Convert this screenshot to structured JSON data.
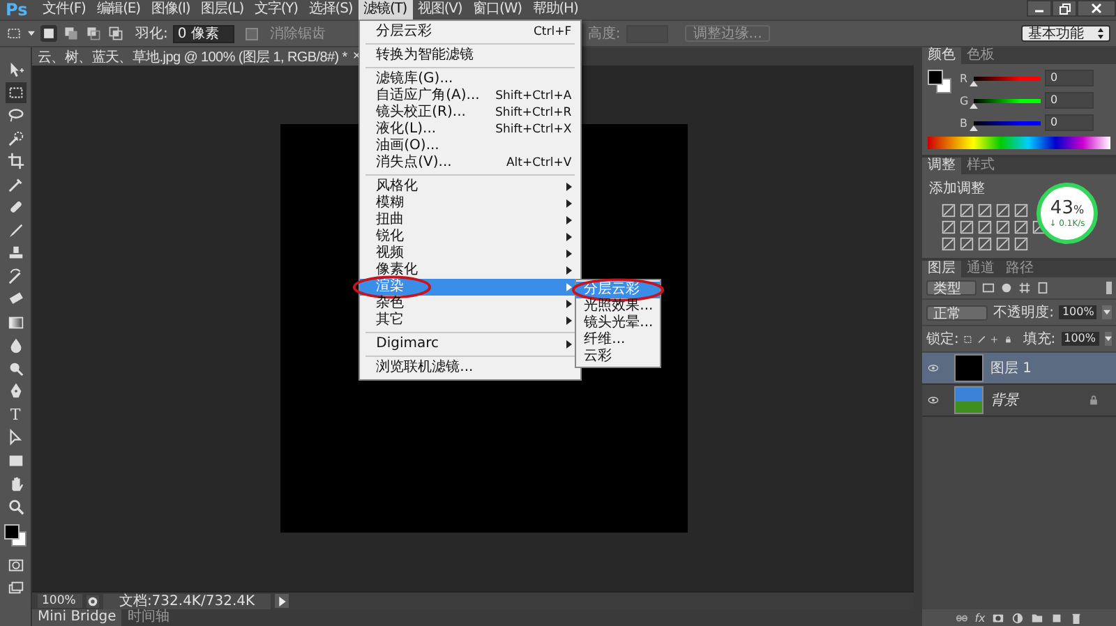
{
  "menu_bar": {
    "logo": "Ps",
    "items": [
      {
        "label": "文件(F)",
        "selected": false
      },
      {
        "label": "编辑(E)",
        "selected": false
      },
      {
        "label": "图像(I)",
        "selected": false
      },
      {
        "label": "图层(L)",
        "selected": false
      },
      {
        "label": "文字(Y)",
        "selected": false
      },
      {
        "label": "选择(S)",
        "selected": false
      },
      {
        "label": "滤镜(T)",
        "selected": true
      },
      {
        "label": "视图(V)",
        "selected": false
      },
      {
        "label": "窗口(W)",
        "selected": false
      },
      {
        "label": "帮助(H)",
        "selected": false
      }
    ]
  },
  "options_bar": {
    "feather_label": "羽化:",
    "feather_value": "0 像素",
    "anti_alias_label": "消除锯齿",
    "anti_alias_checked": false,
    "height_label": "高度:",
    "refine_button": "调整边缘...",
    "workspace": "基本功能"
  },
  "document_tab": {
    "title": "云、树、蓝天、草地.jpg @ 100% (图层 1, RGB/8#) *",
    "close": "×"
  },
  "filter_menu": {
    "items": [
      {
        "kind": "item",
        "label": "分层云彩",
        "shortcut": "Ctrl+F"
      },
      {
        "kind": "separator"
      },
      {
        "kind": "item",
        "label": "转换为智能滤镜"
      },
      {
        "kind": "separator"
      },
      {
        "kind": "item",
        "label": "滤镜库(G)..."
      },
      {
        "kind": "item",
        "label": "自适应广角(A)...",
        "shortcut": "Shift+Ctrl+A"
      },
      {
        "kind": "item",
        "label": "镜头校正(R)...",
        "shortcut": "Shift+Ctrl+R"
      },
      {
        "kind": "item",
        "label": "液化(L)...",
        "shortcut": "Shift+Ctrl+X"
      },
      {
        "kind": "item",
        "label": "油画(O)..."
      },
      {
        "kind": "item",
        "label": "消失点(V)...",
        "shortcut": "Alt+Ctrl+V"
      },
      {
        "kind": "separator"
      },
      {
        "kind": "submenu",
        "label": "风格化",
        "selected": false,
        "circled": false
      },
      {
        "kind": "submenu",
        "label": "模糊",
        "selected": false,
        "circled": false
      },
      {
        "kind": "submenu",
        "label": "扭曲",
        "selected": false,
        "circled": false
      },
      {
        "kind": "submenu",
        "label": "锐化",
        "selected": false,
        "circled": false
      },
      {
        "kind": "submenu",
        "label": "视频",
        "selected": false,
        "circled": false
      },
      {
        "kind": "submenu",
        "label": "像素化",
        "selected": false,
        "circled": false
      },
      {
        "kind": "submenu",
        "label": "渲染",
        "selected": true,
        "circled": true
      },
      {
        "kind": "submenu",
        "label": "杂色",
        "selected": false,
        "circled": false
      },
      {
        "kind": "submenu",
        "label": "其它",
        "selected": false,
        "circled": false
      },
      {
        "kind": "separator"
      },
      {
        "kind": "submenu",
        "label": "Digimarc",
        "selected": false,
        "circled": false
      },
      {
        "kind": "separator"
      },
      {
        "kind": "item",
        "label": "浏览联机滤镜..."
      }
    ]
  },
  "submenu": {
    "items": [
      {
        "label": "分层云彩",
        "selected": true,
        "circled": true
      },
      {
        "label": "光照效果...",
        "selected": false,
        "circled": false
      },
      {
        "label": "镜头光晕...",
        "selected": false,
        "circled": false
      },
      {
        "label": "纤维...",
        "selected": false,
        "circled": false
      },
      {
        "label": "云彩",
        "selected": false,
        "circled": false
      }
    ]
  },
  "toolbar": {
    "type_glyph": "T"
  },
  "color_panel": {
    "tabs": [
      {
        "label": "颜色",
        "selected": true
      },
      {
        "label": "色板",
        "selected": false
      }
    ],
    "channels": [
      {
        "name": "R",
        "color": "#ff0000",
        "level": 0,
        "value": "0"
      },
      {
        "name": "G",
        "color": "#00ff00",
        "level": 0,
        "value": "0"
      },
      {
        "name": "B",
        "color": "#0000ff",
        "level": 0,
        "value": "0"
      }
    ]
  },
  "adjustments_panel": {
    "tabs": [
      {
        "label": "调整",
        "selected": true
      },
      {
        "label": "样式",
        "selected": false
      }
    ],
    "heading": "添加调整"
  },
  "network_meter": {
    "percent": "43",
    "unit": "%",
    "speed": "↓ 0.1K/s"
  },
  "layers_panel": {
    "tabs": [
      {
        "label": "图层",
        "selected": true
      },
      {
        "label": "通道",
        "selected": false
      },
      {
        "label": "路径",
        "selected": false
      }
    ],
    "filter": "类型",
    "blend_mode": "正常",
    "opacity_label": "不透明度:",
    "opacity": "100%",
    "lock_label": "锁定:",
    "fill_label": "填充:",
    "fill": "100%",
    "fx": "fx",
    "layers": [
      {
        "name": "图层 1",
        "kind": "fill",
        "selected": true,
        "visible": true,
        "locked": false
      },
      {
        "name": "背景",
        "kind": "background",
        "selected": false,
        "visible": true,
        "locked": true
      }
    ]
  },
  "status_bar": {
    "zoom": "100%",
    "doc_info": "文档:732.4K/732.4K"
  },
  "bottom_tabs": [
    {
      "label": "Mini Bridge",
      "selected": true
    },
    {
      "label": "时间轴",
      "selected": false
    }
  ]
}
